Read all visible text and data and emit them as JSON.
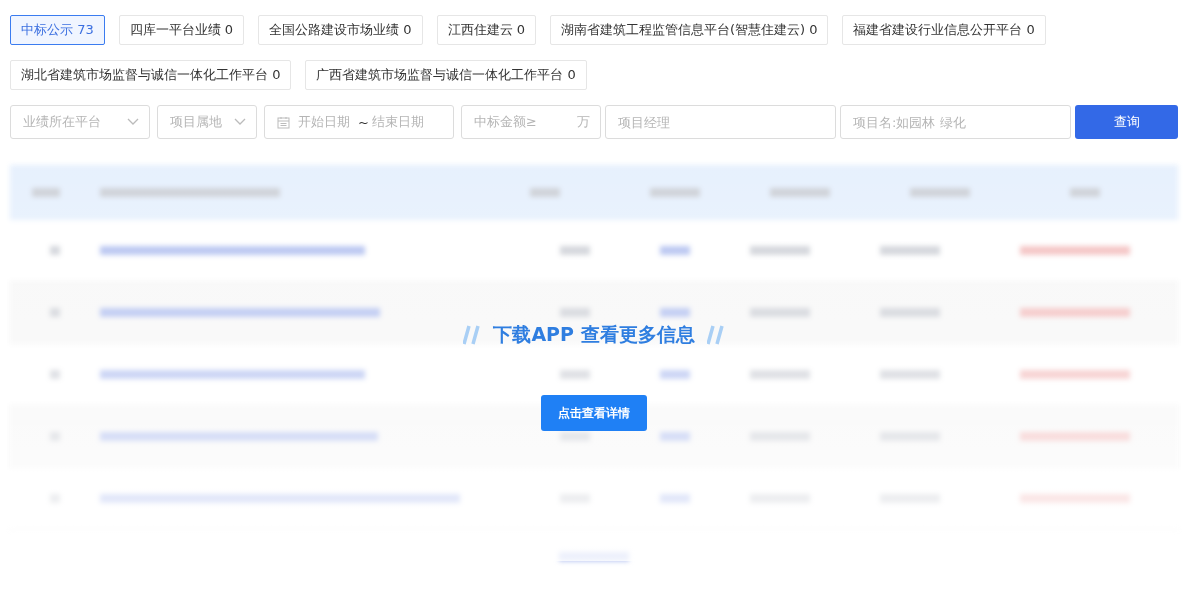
{
  "tabs": [
    {
      "label": "中标公示 73",
      "selected": true
    },
    {
      "label": "四库一平台业绩 0",
      "selected": false
    },
    {
      "label": "全国公路建设市场业绩 0",
      "selected": false
    },
    {
      "label": "江西住建云 0",
      "selected": false
    },
    {
      "label": "湖南省建筑工程监管信息平台(智慧住建云) 0",
      "selected": false
    },
    {
      "label": "福建省建设行业信息公开平台 0",
      "selected": false
    },
    {
      "label": "湖北省建筑市场监督与诚信一体化工作平台 0",
      "selected": false
    },
    {
      "label": "广西省建筑市场监督与诚信一体化工作平台 0",
      "selected": false
    }
  ],
  "filters": [
    {
      "kind": "select",
      "placeholder": "业绩所在平台"
    },
    {
      "kind": "select",
      "placeholder": "项目属地"
    },
    {
      "kind": "daterange",
      "start_placeholder": "开始日期",
      "separator": "~",
      "end_placeholder": "结束日期"
    },
    {
      "kind": "amount",
      "placeholder": "中标金额≥",
      "unit": "万"
    },
    {
      "kind": "text",
      "placeholder": "项目经理"
    },
    {
      "kind": "text",
      "placeholder": "项目名:如园林 绿化"
    }
  ],
  "search_button": "查询",
  "overlay": {
    "title": "下载APP 查看更多信息",
    "button": "点击查看详情"
  }
}
